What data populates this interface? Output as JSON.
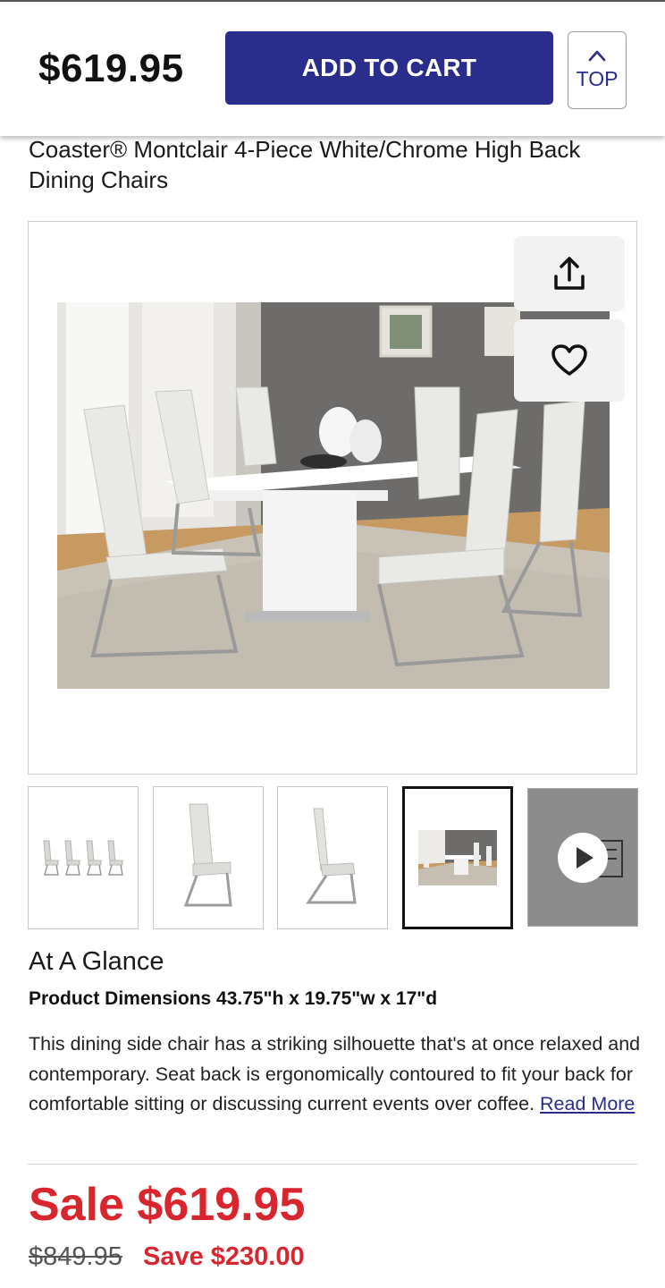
{
  "sticky_bar": {
    "price": "$619.95",
    "add_to_cart_label": "ADD TO CART",
    "top_label": "TOP",
    "top_icon": "chevron-up-icon"
  },
  "product": {
    "title": "Coaster® Montclair 4-Piece White/Chrome High Back Dining Chairs"
  },
  "gallery": {
    "share_icon": "share-icon",
    "favorite_icon": "heart-icon",
    "thumbnails": [
      {
        "kind": "image",
        "active": false
      },
      {
        "kind": "image",
        "active": false
      },
      {
        "kind": "image",
        "active": false
      },
      {
        "kind": "image",
        "active": true
      },
      {
        "kind": "video",
        "active": false,
        "icon": "play-icon"
      }
    ]
  },
  "at_a_glance": {
    "heading": "At A Glance",
    "dimensions": "Product Dimensions 43.75\"h x 19.75\"w x 17\"d",
    "description": "This dining side chair has a striking silhouette that's at once relaxed and contemporary. Seat back is ergonomically contoured to fit your back for comfortable sitting or discussing current events over coffee.",
    "read_more": "Read More"
  },
  "pricing": {
    "sale": "Sale $619.95",
    "original": "$849.95",
    "save": "Save $230.00"
  },
  "colors": {
    "brand": "#2b2d8c",
    "sale": "#d9262e"
  }
}
